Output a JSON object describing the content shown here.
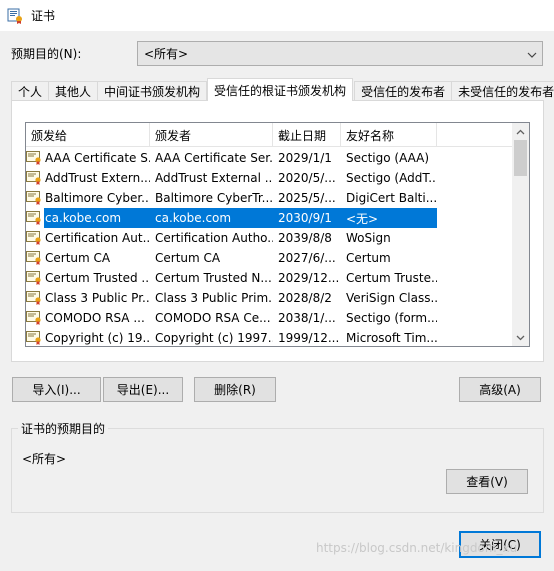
{
  "window": {
    "title": "证书"
  },
  "purpose": {
    "label": "预期目的(N):",
    "selected": "<所有>"
  },
  "tabs": [
    {
      "label": "个人"
    },
    {
      "label": "其他人"
    },
    {
      "label": "中间证书颁发机构"
    },
    {
      "label": "受信任的根证书颁发机构"
    },
    {
      "label": "受信任的发布者"
    },
    {
      "label": "未受信任的发布者"
    }
  ],
  "list": {
    "columns": [
      "颁发给",
      "颁发者",
      "截止日期",
      "友好名称"
    ],
    "rows": [
      {
        "issued_to": "AAA Certificate S...",
        "issued_by": "AAA Certificate Ser...",
        "expires": "2029/1/1",
        "friendly": "Sectigo (AAA)"
      },
      {
        "issued_to": "AddTrust Extern...",
        "issued_by": "AddTrust External ...",
        "expires": "2020/5/...",
        "friendly": "Sectigo (AddT..."
      },
      {
        "issued_to": "Baltimore Cyber...",
        "issued_by": "Baltimore CyberTr...",
        "expires": "2025/5/...",
        "friendly": "DigiCert Balti..."
      },
      {
        "issued_to": "ca.kobe.com",
        "issued_by": "ca.kobe.com",
        "expires": "2030/9/1",
        "friendly": "<无>"
      },
      {
        "issued_to": "Certification Aut...",
        "issued_by": "Certification Autho...",
        "expires": "2039/8/8",
        "friendly": "WoSign"
      },
      {
        "issued_to": "Certum CA",
        "issued_by": "Certum CA",
        "expires": "2027/6/...",
        "friendly": "Certum"
      },
      {
        "issued_to": "Certum Trusted ...",
        "issued_by": "Certum Trusted N...",
        "expires": "2029/12...",
        "friendly": "Certum Truste..."
      },
      {
        "issued_to": "Class 3 Public Pr...",
        "issued_by": "Class 3 Public Prim...",
        "expires": "2028/8/2",
        "friendly": "VeriSign Class..."
      },
      {
        "issued_to": "COMODO RSA ...",
        "issued_by": "COMODO RSA Ce...",
        "expires": "2038/1/...",
        "friendly": "Sectigo (form..."
      },
      {
        "issued_to": "Copyright (c) 19...",
        "issued_by": "Copyright (c) 1997...",
        "expires": "1999/12...",
        "friendly": "Microsoft Tim..."
      }
    ]
  },
  "buttons": {
    "import": "导入(I)...",
    "export": "导出(E)...",
    "remove": "删除(R)",
    "advanced": "高级(A)",
    "view": "查看(V)",
    "close": "关闭(C)"
  },
  "purposes_group": {
    "label": "证书的预期目的",
    "value": "<所有>"
  },
  "watermark": "https://blog.csdn.net/kingdom_xu",
  "colors": {
    "selection": "#0078d7",
    "background": "#f0f0f0"
  }
}
